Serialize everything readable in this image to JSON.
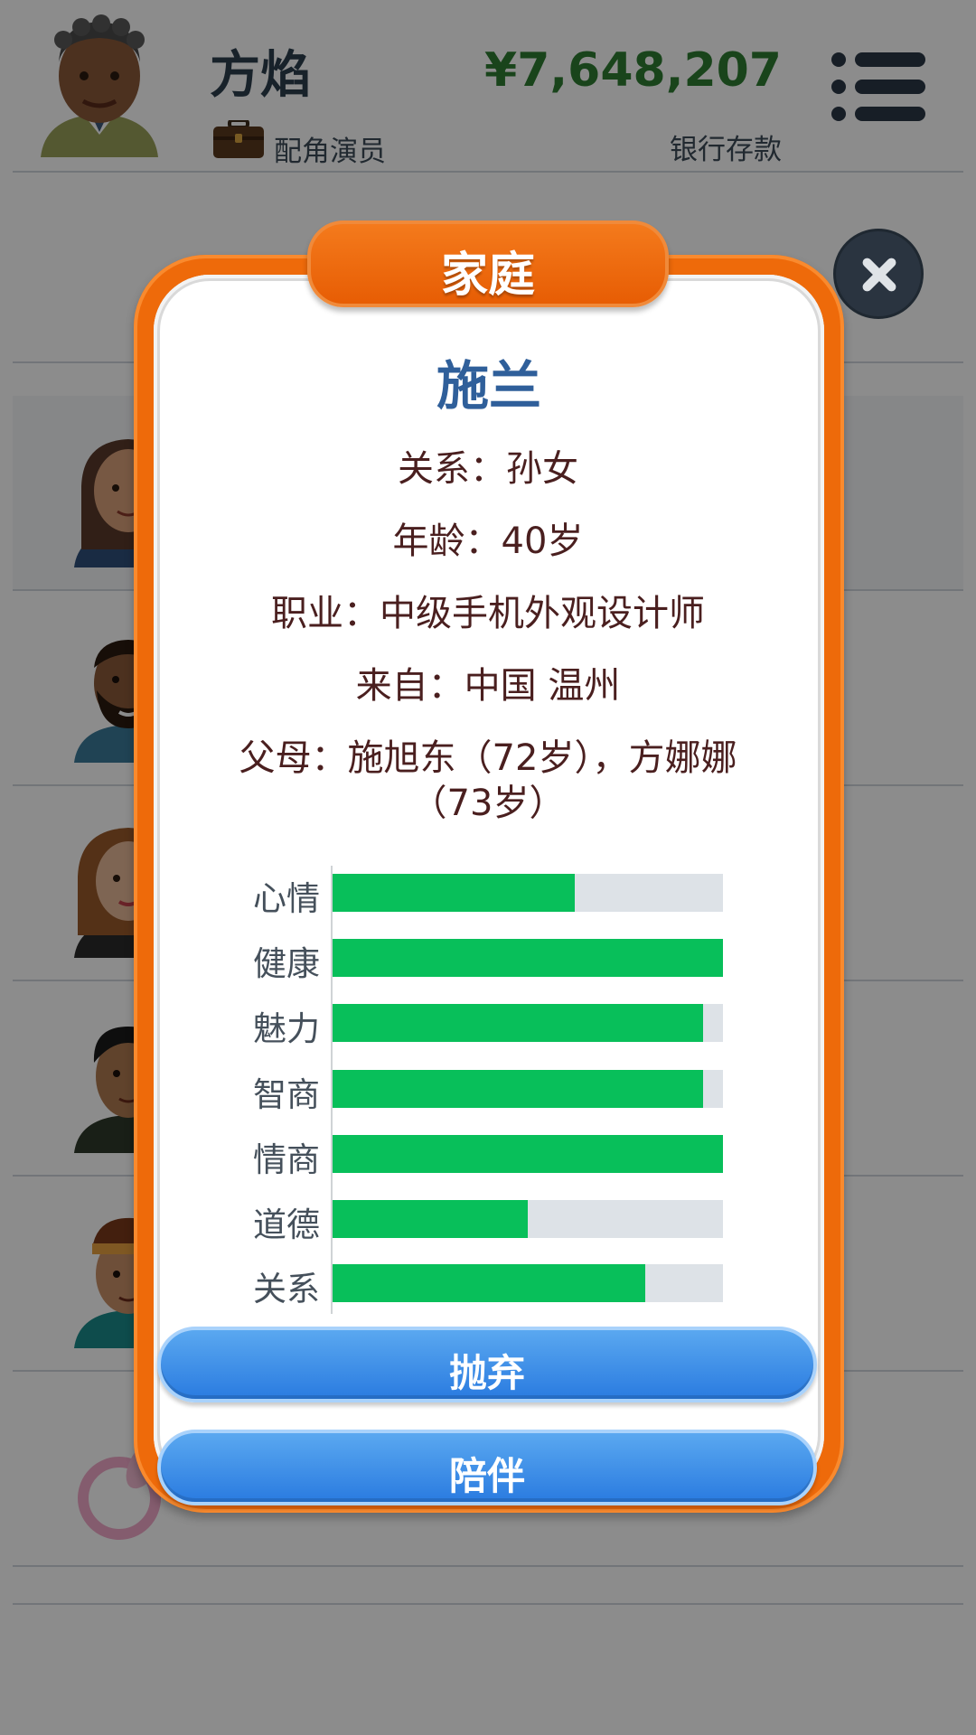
{
  "header": {
    "player_name": "方焰",
    "job_label": "配角演员",
    "money": "¥7,648,207",
    "money_label": "银行存款"
  },
  "dialog": {
    "title": "家庭",
    "person_name": "施兰",
    "info": {
      "relation": "关系：孙女",
      "age": "年龄：40岁",
      "job": "职业：中级手机外观设计师",
      "origin": "来自：中国 温州",
      "parents_line1": "父母：施旭东（72岁），方娜娜",
      "parents_line2": "（73岁）"
    },
    "stats": [
      {
        "label": "心情",
        "value": 0.62
      },
      {
        "label": "健康",
        "value": 1.0
      },
      {
        "label": "魅力",
        "value": 0.95
      },
      {
        "label": "智商",
        "value": 0.95
      },
      {
        "label": "情商",
        "value": 1.0
      },
      {
        "label": "道德",
        "value": 0.5
      },
      {
        "label": "关系",
        "value": 0.8
      }
    ],
    "buttons": {
      "abandon": "抛弃",
      "accompany": "陪伴"
    }
  },
  "colors": {
    "accent_orange": "#ee6a0a",
    "stat_green": "#08bf5a",
    "money_green": "#2e7d32",
    "button_blue": "#2a7be0",
    "name_blue": "#2f5f9a"
  },
  "icons": [
    "briefcase-icon",
    "menu-icon",
    "close-icon"
  ]
}
